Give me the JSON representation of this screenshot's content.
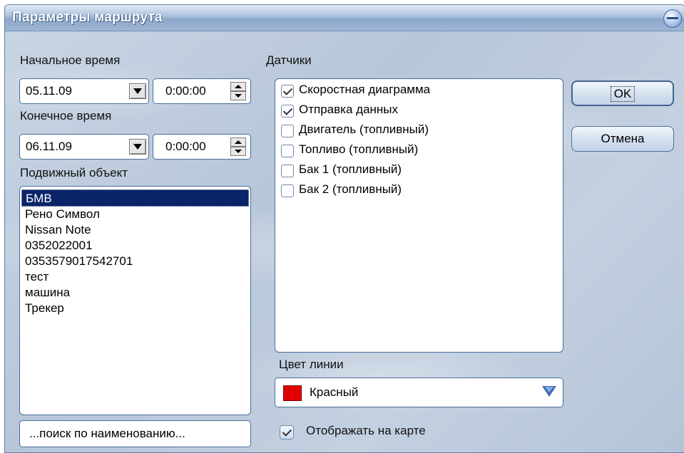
{
  "dialog": {
    "title": "Параметры маршрута"
  },
  "start": {
    "label": "Начальное время",
    "date": "05.11.09",
    "time": "0:00:00"
  },
  "end": {
    "label": "Конечное время",
    "date": "06.11.09",
    "time": "0:00:00"
  },
  "objects": {
    "label": "Подвижный объект",
    "selected_index": 0,
    "items": [
      "БМВ",
      "Рено Символ",
      "Nissan Note",
      "0352022001",
      "0353579017542701",
      "тест",
      "машина",
      "Трекер"
    ],
    "search_button": "...поиск по наименованию..."
  },
  "sensors": {
    "label": "Датчики",
    "items": [
      {
        "label": "Скоростная диаграмма",
        "checked": true
      },
      {
        "label": "Отправка данных",
        "checked": true
      },
      {
        "label": "Двигатель (топливный)",
        "checked": false
      },
      {
        "label": "Топливо (топливный)",
        "checked": false
      },
      {
        "label": "Бак 1 (топливный)",
        "checked": false
      },
      {
        "label": "Бак 2 (топливный)",
        "checked": false
      }
    ]
  },
  "line_color": {
    "label": "Цвет линии",
    "value": "Красный",
    "swatch_color": "#e00000"
  },
  "show_on_map": {
    "label": "Отображать на карте",
    "checked": true
  },
  "buttons": {
    "ok": "OK",
    "cancel": "Отмена"
  }
}
